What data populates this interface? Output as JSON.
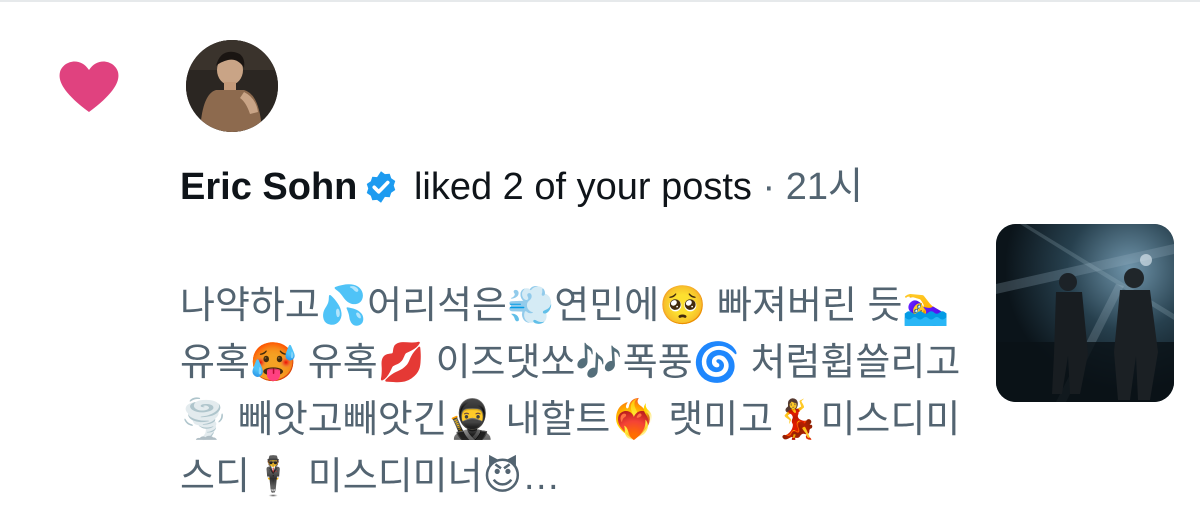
{
  "notification": {
    "icon": "heart-icon",
    "accent_color": "#e0427f",
    "user": {
      "name": "Eric Sohn",
      "verified": true,
      "verified_color": "#1d9bf0"
    },
    "action": "liked 2 of your posts",
    "separator": "·",
    "time": "21시",
    "post_text": "나약하고💦어리석은💨연민에🥺 빠져버린 듯🏊‍♀️유혹🥵 유혹💋 이즈댓쏘🎶폭풍🌀 처럼휩쓸리고🌪️ 빼앗고빼앗긴🥷 내할트❤️‍🔥 랫미고💃미스디미스디🕴️ 미스디미너😈…"
  }
}
